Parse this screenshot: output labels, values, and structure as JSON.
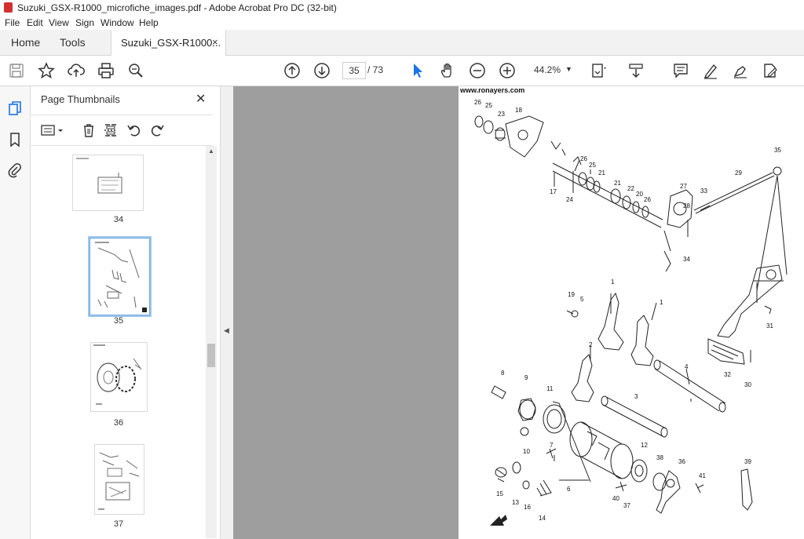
{
  "window": {
    "title": "Suzuki_GSX-R1000_microfiche_images.pdf - Adobe Acrobat Pro DC (32-bit)"
  },
  "menu": [
    "File",
    "Edit",
    "View",
    "Sign",
    "Window",
    "Help"
  ],
  "tabs": {
    "home": "Home",
    "tools": "Tools",
    "document": "Suzuki_GSX-R1000...",
    "close": "×"
  },
  "toolbar": {
    "current_page": "35",
    "page_separator": "/ 73",
    "zoom": "44.2%",
    "icons": [
      "save-icon",
      "bookmark-star-icon",
      "upload-cloud-icon",
      "print-icon",
      "search-zoom-icon",
      "prev-page-icon",
      "next-page-icon",
      "select-cursor-icon",
      "hand-tool-icon",
      "zoom-out-icon",
      "zoom-in-icon",
      "zoom-dropdown-icon",
      "page-view-icon",
      "scroll-mode-icon",
      "comment-icon",
      "highlight-pen-icon",
      "fill-sign-icon",
      "edit-pdf-icon"
    ]
  },
  "panel": {
    "title": "Page Thumbnails",
    "close": "✕",
    "thumbnails": [
      {
        "label": "34"
      },
      {
        "label": "35",
        "selected": true
      },
      {
        "label": "36"
      },
      {
        "label": "37"
      }
    ]
  },
  "page": {
    "watermark": "www.ronayers.com",
    "callouts": [
      "26",
      "25",
      "23",
      "18",
      "35",
      "26",
      "25",
      "21",
      "29",
      "17",
      "24",
      "21",
      "22",
      "20",
      "26",
      "27",
      "33",
      "28",
      "34",
      "19",
      "5",
      "1",
      "1",
      "2",
      "31",
      "8",
      "9",
      "4",
      "3",
      "32",
      "30",
      "11",
      "10",
      "7",
      "12",
      "38",
      "36",
      "39",
      "15",
      "13",
      "16",
      "14",
      "6",
      "40",
      "37",
      "41"
    ]
  },
  "colors": {
    "accent_red": "#d32f2f",
    "viewer_gray": "#9e9e9e",
    "select_blue": "#1a73e8"
  }
}
